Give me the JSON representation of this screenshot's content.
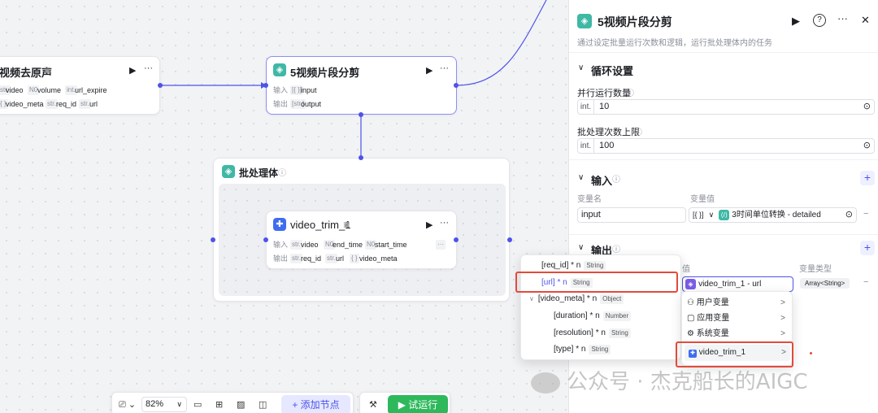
{
  "canvas": {
    "node_denoise": {
      "title": "视频去原声",
      "tags": [
        "str.",
        "N0",
        "int.",
        "{ }",
        "str.",
        "str."
      ],
      "params": [
        "video",
        "volume",
        "url_expire",
        "video_meta",
        "req_id",
        "url"
      ]
    },
    "node_trim": {
      "title": "5视频片段分剪",
      "in_label": "输入",
      "out_label": "输出",
      "in_tag": "[{ }]",
      "in_param": "input",
      "out_tag": "[str.]",
      "out_param": "output"
    },
    "batch_body": {
      "title": "批处理体"
    },
    "node_inner": {
      "title": "video_trim_1",
      "in_label": "输入",
      "out_label": "输出",
      "in_params": [
        {
          "tag": "str.",
          "name": "video"
        },
        {
          "tag": "N0",
          "name": "end_time"
        },
        {
          "tag": "N0",
          "name": "start_time"
        }
      ],
      "out_params": [
        {
          "tag": "str.",
          "name": "req_id"
        },
        {
          "tag": "str.",
          "name": "url"
        },
        {
          "tag": "{ }",
          "name": "video_meta"
        }
      ],
      "more": "···"
    }
  },
  "icons": {
    "run": "▶",
    "more": "···",
    "info": "ⓘ",
    "close": "✕",
    "help": "?",
    "chevron_down": "∨",
    "chevron_right": ">"
  },
  "toolbar": {
    "zoom": "82%",
    "add_node": "+ 添加节点",
    "run": "▶ 试运行"
  },
  "panel": {
    "title": "5视频片段分剪",
    "desc": "通过设定批量运行次数和逻辑，运行批处理体内的任务",
    "loop": {
      "title": "循环设置",
      "concurrency_label": "并行运行数量",
      "concurrency_prefix": "int.",
      "concurrency_value": "10",
      "batch_label": "批处理次数上限",
      "batch_prefix": "int.",
      "batch_value": "100"
    },
    "input": {
      "title": "输入",
      "col_name": "变量名",
      "col_value": "变量值",
      "var_name": "input",
      "var_type": "[{ }]",
      "var_ref": "3时间单位转换 - detailed"
    },
    "output": {
      "title": "输出",
      "col_value": "值",
      "col_type": "变量类型",
      "ref": "video_trim_1 - url",
      "type": "Array<String>"
    }
  },
  "dropdown_left": {
    "rows": [
      {
        "label": "[req_id] * n",
        "type": "String"
      },
      {
        "label": "[url] * n",
        "type": "String"
      },
      {
        "label": "[video_meta] * n",
        "type": "Object"
      },
      {
        "label": "[duration] * n",
        "type": "Number"
      },
      {
        "label": "[resolution] * n",
        "type": "String"
      },
      {
        "label": "[type] * n",
        "type": "String"
      }
    ]
  },
  "dropdown_right": {
    "items": [
      {
        "label": "用户变量",
        "icon": "user-icon"
      },
      {
        "label": "应用变量",
        "icon": "folder-icon"
      },
      {
        "label": "系统变量",
        "icon": "gear-icon"
      },
      {
        "label": "video_trim_1",
        "icon": "node-icon"
      }
    ]
  },
  "watermark": "公众号 · 杰克船长的AIGC",
  "colors": {
    "accent": "#4d53e8",
    "highlight": "#e14b3b",
    "run_green": "#2eb85c",
    "teal": "#3fb8a6"
  }
}
